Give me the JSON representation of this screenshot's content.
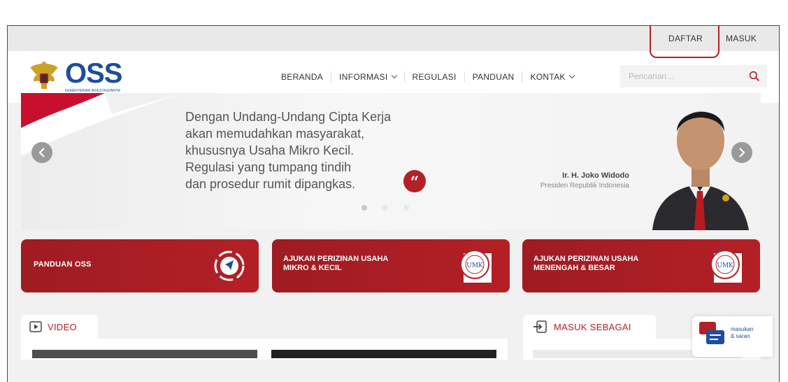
{
  "topbar": {
    "register_label": "DAFTAR",
    "login_label": "MASUK"
  },
  "brand": {
    "logo_text": "OSS",
    "logo_subtitle": "KEMENTERIAN INVESTASI/BKPM"
  },
  "nav": {
    "items": [
      {
        "label": "BERANDA"
      },
      {
        "label": "INFORMASI"
      },
      {
        "label": "REGULASI"
      },
      {
        "label": "PANDUAN"
      },
      {
        "label": "KONTAK"
      }
    ],
    "search_placeholder": "Pencarian..."
  },
  "hero": {
    "quote_lines": [
      "Dengan Undang-Undang Cipta Kerja",
      "akan memudahkan masyarakat,",
      "khususnya Usaha Mikro Kecil.",
      "Regulasi yang tumpang tindih",
      "dan prosedur rumit dipangkas."
    ],
    "quote_icon": "“",
    "person_name": "Ir. H. Joko Widodo",
    "person_role": "Presiden Republik Indonesia",
    "slide_count": 3,
    "active_slide": 1
  },
  "cards": [
    {
      "label": "PANDUAN OSS",
      "icon": "compass-icon"
    },
    {
      "label_line1": "AJUKAN PERIZINAN USAHA",
      "label_line2": "MIKRO & KECIL",
      "badge": "UMK"
    },
    {
      "label_line1": "AJUKAN PERIZINAN USAHA",
      "label_line2": "MENENGAH & BESAR",
      "badge": "UMK"
    }
  ],
  "sections": {
    "video_label": "VIDEO",
    "login_as_label": "MASUK SEBAGAI"
  },
  "feedback": {
    "line1": "masukan",
    "line2": "& saran"
  },
  "colors": {
    "accent": "#b32026",
    "brand_blue": "#1d4e9b",
    "topbar": "#e9e9ea",
    "page_bg": "#f1f1f1"
  }
}
